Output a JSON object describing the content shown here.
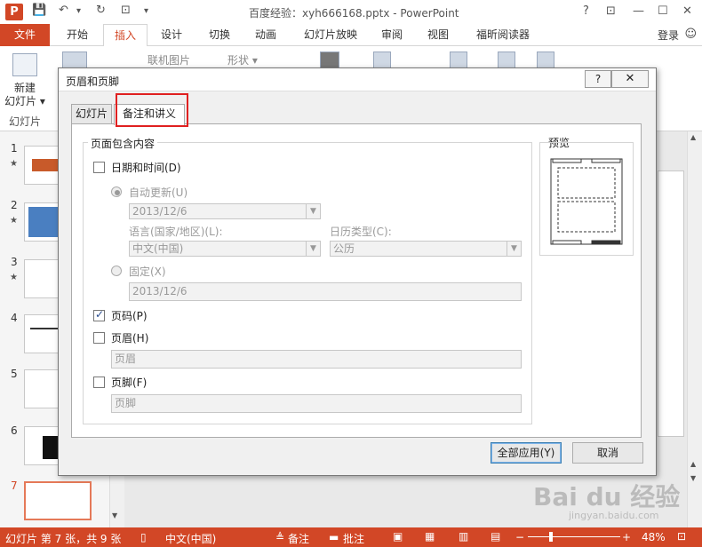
{
  "app": {
    "icon_letter": "P",
    "title": "百度经验：xyh666168.pptx - PowerPoint",
    "qat": {
      "save": "💾",
      "undo": "↶",
      "undo_drop": "▾",
      "redo": "↻",
      "present": "⊡",
      "more": "▾"
    },
    "controls": {
      "help": "?",
      "restore": "⊡",
      "minimize": "—",
      "maximize": "☐",
      "close": "✕"
    }
  },
  "ribbon": {
    "tabs": [
      "文件",
      "开始",
      "插入",
      "设计",
      "切换",
      "动画",
      "幻灯片放映",
      "审阅",
      "视图",
      "福昕阅读器"
    ],
    "active_tab": "插入",
    "login": "登录",
    "new_slide": "新建\n幻灯片 ▾",
    "group_slides": "幻灯片",
    "online_pictures": "联机图片",
    "shapes": "形状 ▾"
  },
  "thumbnails": [
    {
      "num": "1",
      "star": "★"
    },
    {
      "num": "2",
      "star": "★"
    },
    {
      "num": "3",
      "star": "★"
    },
    {
      "num": "4",
      "star": ""
    },
    {
      "num": "5",
      "star": ""
    },
    {
      "num": "6",
      "star": ""
    },
    {
      "num": "7",
      "star": ""
    }
  ],
  "dialog": {
    "title": "页眉和页脚",
    "help": "?",
    "close": "✕",
    "tabs": [
      "幻灯片",
      "备注和讲义"
    ],
    "active_tab": "备注和讲义",
    "group_label": "页面包含内容",
    "date_time": {
      "label": "日期和时间(D)",
      "checked": false
    },
    "auto_update": {
      "label": "自动更新(U)",
      "value": "2013/12/6"
    },
    "language": {
      "label": "语言(国家/地区)(L):",
      "value": "中文(中国)"
    },
    "calendar": {
      "label": "日历类型(C):",
      "value": "公历"
    },
    "fixed": {
      "label": "固定(X)",
      "value": "2013/12/6"
    },
    "page_number": {
      "label": "页码(P)",
      "checked": true
    },
    "header": {
      "label": "页眉(H)",
      "checked": false,
      "value": "页眉"
    },
    "footer": {
      "label": "页脚(F)",
      "checked": false,
      "value": "页脚"
    },
    "preview_label": "预览",
    "apply_all": "全部应用(Y)",
    "cancel": "取消"
  },
  "status": {
    "slide_info": "幻灯片 第 7 张，共 9 张",
    "language": "中文(中国)",
    "notes": "备注",
    "comments": "批注",
    "zoom": "48%",
    "zoom_minus": "−",
    "zoom_plus": "+"
  },
  "watermark": {
    "logo": "Bai du 经验",
    "sub": "jingyan.baidu.com"
  },
  "colors": {
    "accent": "#d24726",
    "highlight": "#e02020"
  }
}
